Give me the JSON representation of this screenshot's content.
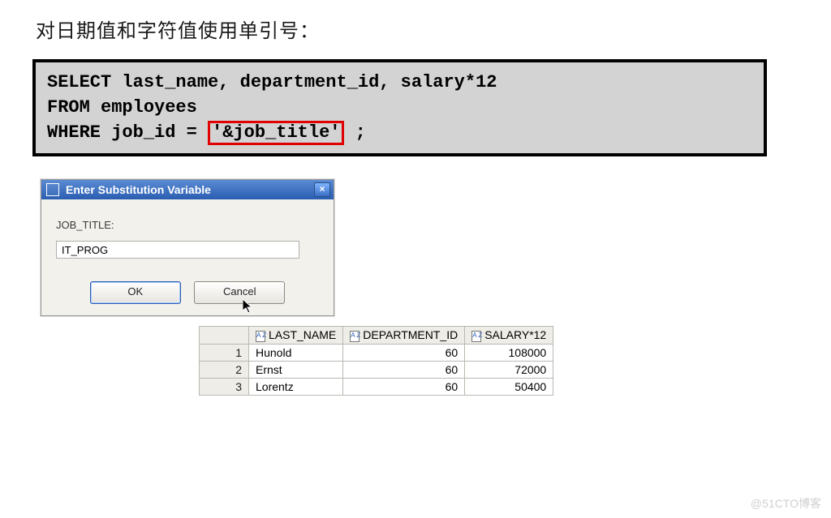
{
  "heading": "对日期值和字符值使用单引号：",
  "sql": {
    "line1a": "SELECT last_name, department_id, salary*12",
    "line2a": "FROM   employees",
    "line3a": "WHERE  job_id = ",
    "highlight": "'&job_title'",
    "line3b": " ;"
  },
  "dialog": {
    "title": "Enter Substitution Variable",
    "close": "×",
    "label": "JOB_TITLE:",
    "value": "IT_PROG",
    "ok": "OK",
    "cancel": "Cancel"
  },
  "table": {
    "headers": {
      "c1": "LAST_NAME",
      "c2": "DEPARTMENT_ID",
      "c3": "SALARY*12"
    },
    "az": "A\nZ",
    "rows": [
      {
        "n": "1",
        "last_name": "Hunold",
        "dept": "60",
        "sal": "108000"
      },
      {
        "n": "2",
        "last_name": "Ernst",
        "dept": "60",
        "sal": "72000"
      },
      {
        "n": "3",
        "last_name": "Lorentz",
        "dept": "60",
        "sal": "50400"
      }
    ]
  },
  "watermark": "@51CTO博客"
}
